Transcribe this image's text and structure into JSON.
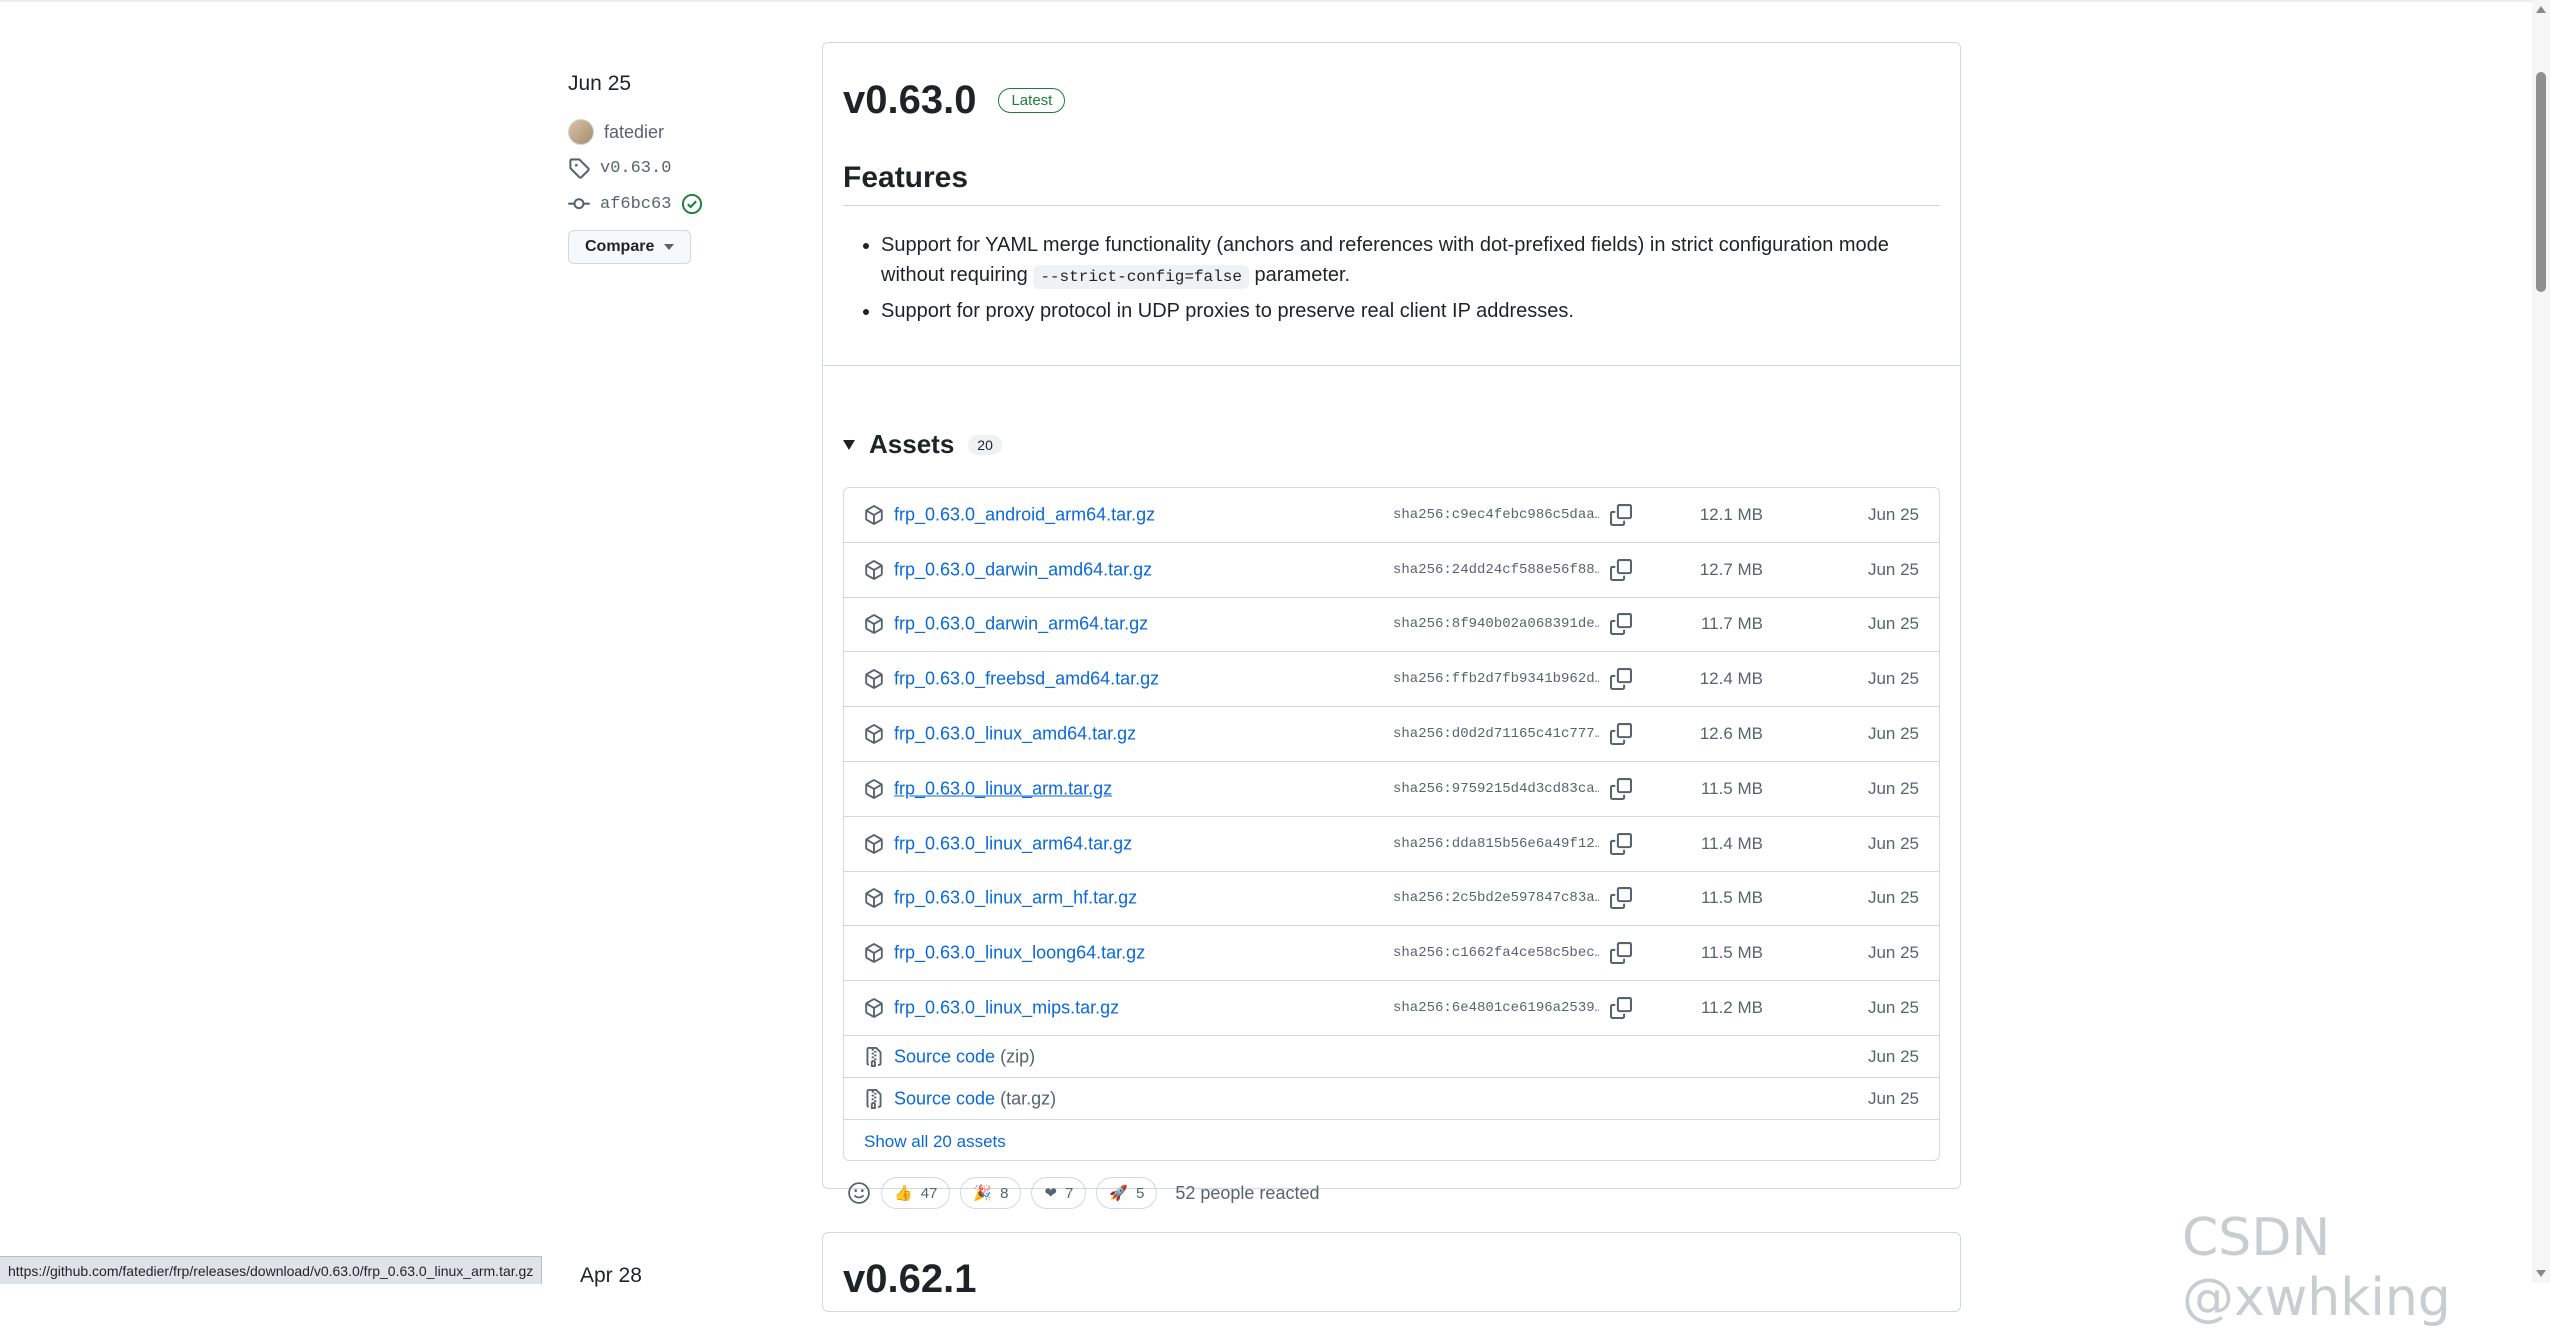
{
  "meta": {
    "date": "Jun 25",
    "author": "fatedier",
    "tag": "v0.63.0",
    "commit": "af6bc63",
    "compare_label": "Compare"
  },
  "release": {
    "title": "v0.63.0",
    "badge": "Latest",
    "features_heading": "Features",
    "notes": [
      {
        "before": "Support for YAML merge functionality (anchors and references with dot-prefixed fields) in strict configuration mode without requiring ",
        "code": "--strict-config=false",
        "after": " parameter."
      },
      {
        "before": "Support for proxy protocol in UDP proxies to preserve real client IP addresses.",
        "code": "",
        "after": ""
      }
    ]
  },
  "assets": {
    "title": "Assets",
    "count": "20",
    "items": [
      {
        "name": "frp_0.63.0_android_arm64.tar.gz",
        "sha": "sha256:c9ec4febc986c5daa…",
        "size": "12.1 MB",
        "date": "Jun 25"
      },
      {
        "name": "frp_0.63.0_darwin_amd64.tar.gz",
        "sha": "sha256:24dd24cf588e56f88…",
        "size": "12.7 MB",
        "date": "Jun 25"
      },
      {
        "name": "frp_0.63.0_darwin_arm64.tar.gz",
        "sha": "sha256:8f940b02a068391de…",
        "size": "11.7 MB",
        "date": "Jun 25"
      },
      {
        "name": "frp_0.63.0_freebsd_amd64.tar.gz",
        "sha": "sha256:ffb2d7fb9341b962d…",
        "size": "12.4 MB",
        "date": "Jun 25"
      },
      {
        "name": "frp_0.63.0_linux_amd64.tar.gz",
        "sha": "sha256:d0d2d71165c41c777…",
        "size": "12.6 MB",
        "date": "Jun 25"
      },
      {
        "name": "frp_0.63.0_linux_arm.tar.gz",
        "sha": "sha256:9759215d4d3cd83ca…",
        "size": "11.5 MB",
        "date": "Jun 25"
      },
      {
        "name": "frp_0.63.0_linux_arm64.tar.gz",
        "sha": "sha256:dda815b56e6a49f12…",
        "size": "11.4 MB",
        "date": "Jun 25"
      },
      {
        "name": "frp_0.63.0_linux_arm_hf.tar.gz",
        "sha": "sha256:2c5bd2e597847c83a…",
        "size": "11.5 MB",
        "date": "Jun 25"
      },
      {
        "name": "frp_0.63.0_linux_loong64.tar.gz",
        "sha": "sha256:c1662fa4ce58c5bec…",
        "size": "11.5 MB",
        "date": "Jun 25"
      },
      {
        "name": "frp_0.63.0_linux_mips.tar.gz",
        "sha": "sha256:6e4801ce6196a2539…",
        "size": "11.2 MB",
        "date": "Jun 25"
      }
    ],
    "source": [
      {
        "label": "Source code",
        "kind": "(zip)",
        "date": "Jun 25"
      },
      {
        "label": "Source code",
        "kind": "(tar.gz)",
        "date": "Jun 25"
      }
    ],
    "show_all": "Show all 20 assets"
  },
  "reactions": {
    "items": [
      {
        "emoji": "👍",
        "count": "47"
      },
      {
        "emoji": "🎉",
        "count": "8"
      },
      {
        "emoji": "❤",
        "count": "7"
      },
      {
        "emoji": "🚀",
        "count": "5"
      }
    ],
    "summary": "52 people reacted"
  },
  "next_release": {
    "title": "v0.62.1",
    "date": "Apr 28"
  },
  "statusbar": {
    "url": "https://github.com/fatedier/frp/releases/download/v0.63.0/frp_0.63.0_linux_arm.tar.gz"
  },
  "watermark": "CSDN @xwhking",
  "colors": {
    "link": "#0969da",
    "latest_green": "#1a7f37",
    "border": "#d1d9e0",
    "muted": "#59636e"
  }
}
